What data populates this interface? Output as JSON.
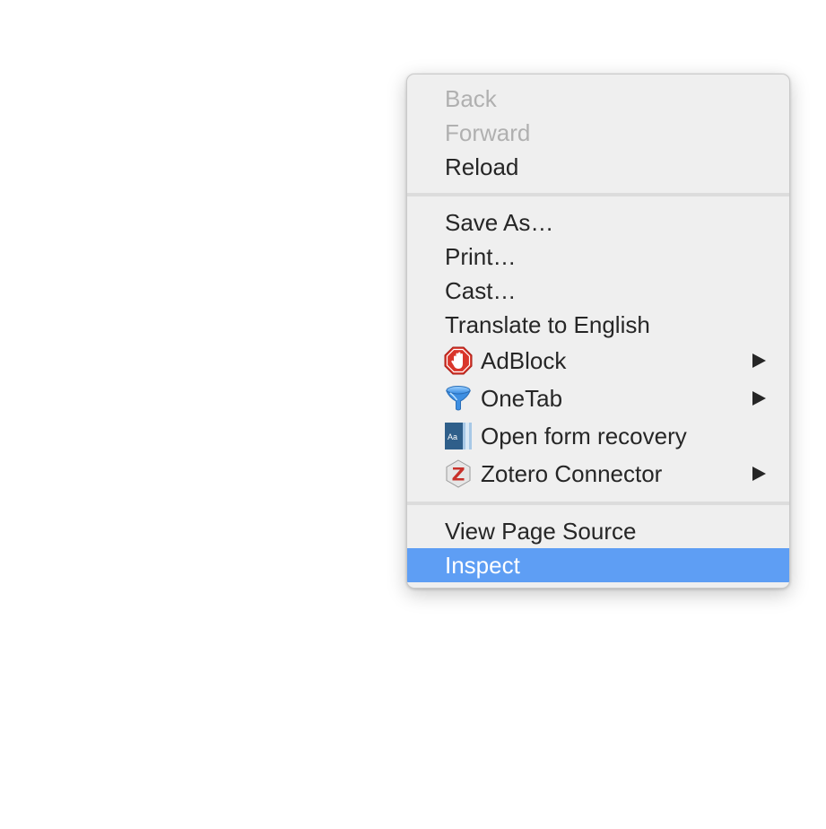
{
  "menu": {
    "items": [
      {
        "label": "Back",
        "state": "disabled"
      },
      {
        "label": "Forward",
        "state": "disabled"
      },
      {
        "label": "Reload",
        "state": "enabled"
      },
      {
        "label": "Save As…",
        "state": "enabled"
      },
      {
        "label": "Print…",
        "state": "enabled"
      },
      {
        "label": "Cast…",
        "state": "enabled"
      },
      {
        "label": "Translate to English",
        "state": "enabled"
      },
      {
        "label": "AdBlock",
        "icon": "adblock-hand-icon",
        "submenu": true
      },
      {
        "label": "OneTab",
        "icon": "onetab-funnel-icon",
        "submenu": true
      },
      {
        "label": "Open form recovery",
        "icon": "form-recovery-icon",
        "submenu": false
      },
      {
        "label": "Zotero Connector",
        "icon": "zotero-z-icon",
        "submenu": true
      },
      {
        "label": "View Page Source",
        "state": "enabled"
      },
      {
        "label": "Inspect",
        "state": "highlighted"
      }
    ]
  },
  "colors": {
    "menu_background": "#efefef",
    "highlight": "#5e9ef4",
    "text": "#262626",
    "disabled_text": "#b0b0b0",
    "separator": "#dcdcdc"
  }
}
